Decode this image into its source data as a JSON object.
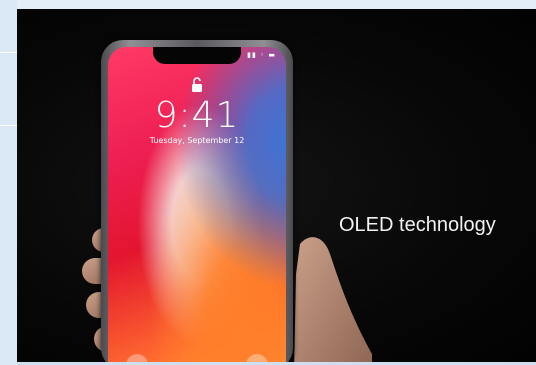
{
  "lock_screen": {
    "time": "9:41",
    "date": "Tuesday, September 12",
    "status_icons": "▮▮ ◦ ▬"
  },
  "caption": {
    "text": "OLED technology"
  },
  "icons": [
    "lock-open-icon",
    "signal-icon",
    "wifi-icon",
    "battery-icon",
    "flashlight-icon",
    "camera-icon"
  ]
}
